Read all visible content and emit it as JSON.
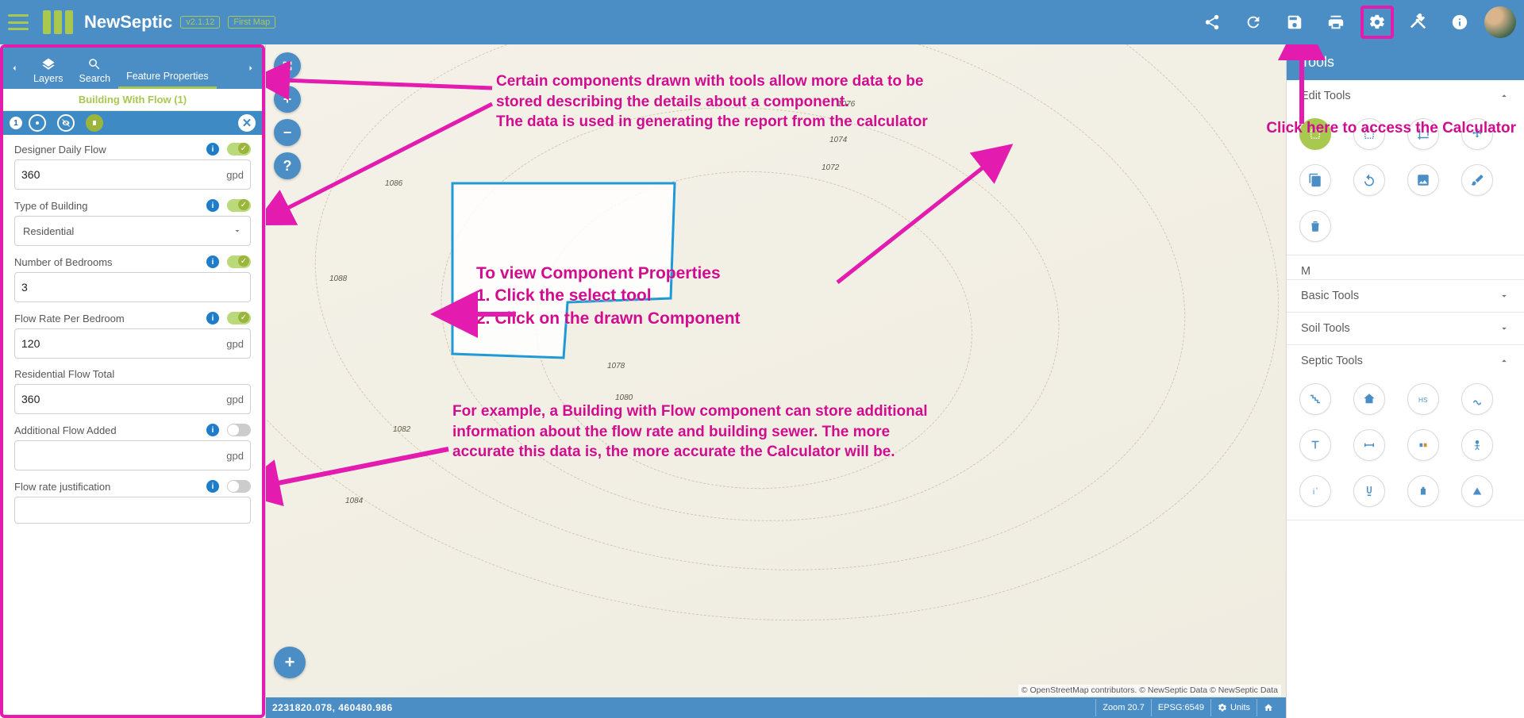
{
  "app": {
    "name": "NewSeptic",
    "version": "v2.1.12",
    "map_name": "First Map"
  },
  "topbar_icons": [
    "share",
    "refresh",
    "save",
    "print",
    "settings",
    "tools",
    "info",
    "avatar"
  ],
  "sidepanel": {
    "tabs": {
      "layers": "Layers",
      "search": "Search",
      "feature": "Feature Properties"
    },
    "feature_header": "Building With Flow (1)",
    "toolbar_badge": "1",
    "properties": [
      {
        "key": "daily_flow",
        "label": "Designer Daily Flow",
        "value": "360",
        "unit": "gpd",
        "info": true,
        "toggle": "on",
        "type": "text"
      },
      {
        "key": "type_building",
        "label": "Type of Building",
        "value": "Residential",
        "info": true,
        "toggle": "on",
        "type": "select"
      },
      {
        "key": "bedrooms",
        "label": "Number of Bedrooms",
        "value": "3",
        "info": true,
        "toggle": "on",
        "type": "text"
      },
      {
        "key": "flow_per_bed",
        "label": "Flow Rate Per Bedroom",
        "value": "120",
        "unit": "gpd",
        "info": true,
        "toggle": "on",
        "type": "text"
      },
      {
        "key": "res_total",
        "label": "Residential Flow Total",
        "value": "360",
        "unit": "gpd",
        "info": false,
        "toggle": null,
        "type": "text"
      },
      {
        "key": "add_flow",
        "label": "Additional Flow Added",
        "value": "",
        "unit": "gpd",
        "info": true,
        "toggle": "off",
        "type": "text"
      },
      {
        "key": "justification",
        "label": "Flow rate justification",
        "value": "",
        "info": true,
        "toggle": "off",
        "type": "textarea"
      }
    ]
  },
  "map": {
    "coords": "2231820.078, 460480.986",
    "zoom": "Zoom 20.7",
    "epsg": "EPSG:6549",
    "units_label": "Units",
    "attribution_osm": "© OpenStreetMap contributors.",
    "attribution_ns": "© NewSeptic Data © NewSeptic Data",
    "elev_labels": [
      "1072",
      "1074",
      "1076",
      "1078",
      "1080",
      "1082",
      "1084",
      "1086",
      "1088"
    ]
  },
  "toolspanel": {
    "title": "Tools",
    "sections": {
      "edit": "Edit Tools",
      "m_cut": "M",
      "basic": "Basic Tools",
      "soil": "Soil Tools",
      "septic": "Septic Tools"
    }
  },
  "annotations": {
    "a1": "Certain components drawn with tools allow more data to be stored describing the details about a component.\nThe data is used in generating the report from the calculator",
    "a2": "To view Component Properties\n        1. Click the select tool\n2. Click on the drawn Component",
    "a3": "For example, a Building with Flow component can store additional information about the flow rate and building sewer. The more accurate this data is, the more accurate the Calculator will be.",
    "a4": "Click here to access the Calculator"
  }
}
